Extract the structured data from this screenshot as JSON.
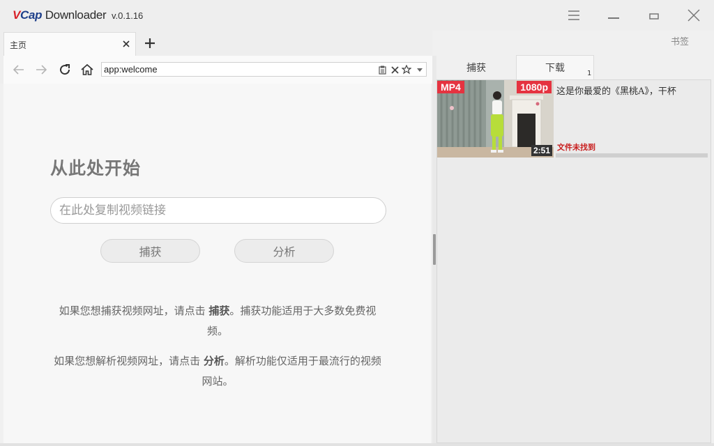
{
  "window": {
    "logo_v": "V",
    "logo_cap": "Cap",
    "logo_rest": " Downloader",
    "version": "v.0.1.16",
    "buttons": [
      "menu-icon",
      "minimize-icon",
      "maximize-icon",
      "close-icon"
    ]
  },
  "tabs": {
    "items": [
      {
        "label": "主页"
      }
    ],
    "bookmarks_label": "书签"
  },
  "navbar": {
    "url": "app:welcome",
    "icons": [
      "back-icon",
      "forward-icon",
      "reload-icon",
      "home-icon",
      "clipboard-icon",
      "clear-icon",
      "star-icon",
      "dropdown-icon"
    ]
  },
  "welcome": {
    "heading": "从此处开始",
    "input_placeholder": "在此处复制视频链接",
    "capture_label": "捕获",
    "analyze_label": "分析",
    "capture_help_pre": "如果您想捕获视频网址，请点击 ",
    "capture_help_keyword": "捕获",
    "capture_help_post": "。捕获功能适用于大多数免费视频。",
    "analyze_help_pre": "如果您想解析视频网址，请点击 ",
    "analyze_help_keyword": "分析",
    "analyze_help_post": "。解析功能仅适用于最流行的视频网站。"
  },
  "right_pane": {
    "tabs": [
      {
        "label": "捕获"
      },
      {
        "label": "下载"
      }
    ],
    "download_count": "1",
    "downloads": [
      {
        "format": "MP4",
        "quality": "1080p",
        "duration": "2:51",
        "title": "这是你最爱的《黑桃A》，干杯",
        "status": "文件未找到",
        "progress": 0
      }
    ]
  },
  "colors": {
    "badge": "#e53340",
    "status": "#c81e1e",
    "logo_red": "#d8232a",
    "logo_blue": "#1e3f8a"
  }
}
